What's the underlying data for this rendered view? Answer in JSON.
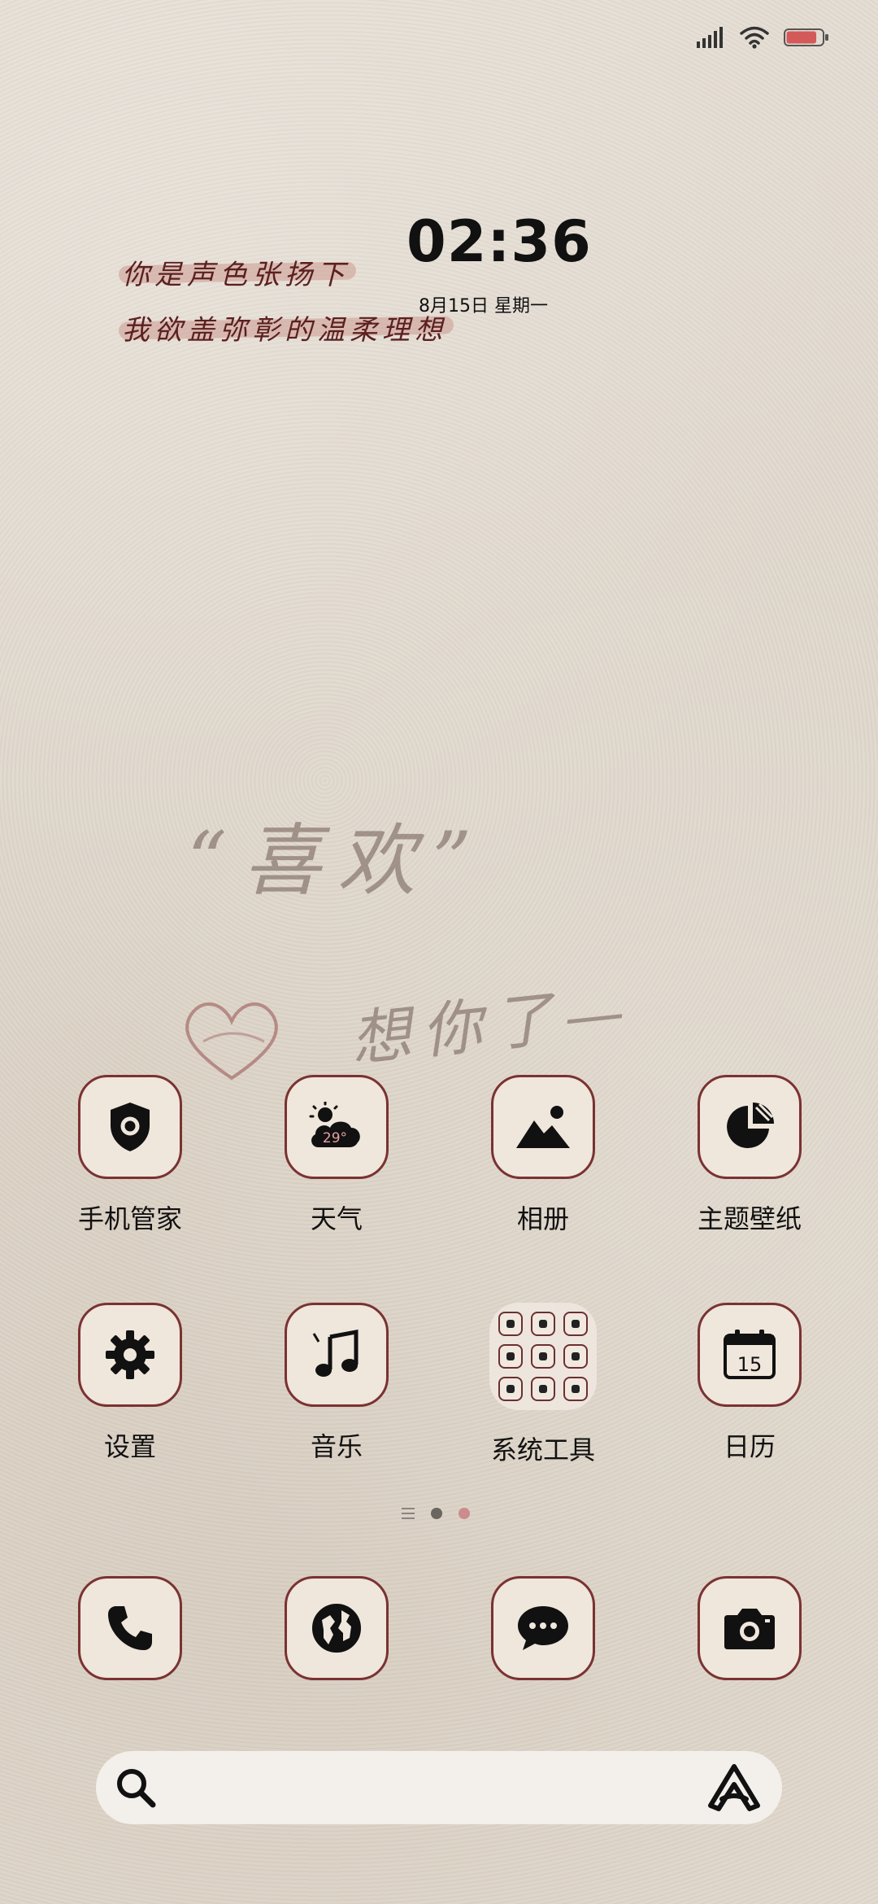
{
  "status_bar": {
    "signal_icon": "signal-bars-icon",
    "wifi_icon": "wifi-icon",
    "battery_icon": "battery-icon",
    "battery_level": 0.85,
    "battery_color": "#d45a5a"
  },
  "clock": {
    "time": "02:36",
    "date": "8月15日  星期一"
  },
  "wallpaper": {
    "line1": "你是声色张扬下",
    "line2": "我欲盖弥彰的温柔理想",
    "big1": "“喜欢”",
    "big2": "想你了—"
  },
  "apps": [
    {
      "label": "手机管家",
      "icon": "shield-icon"
    },
    {
      "label": "天气",
      "icon": "weather-icon",
      "temp": "29°"
    },
    {
      "label": "相册",
      "icon": "gallery-icon"
    },
    {
      "label": "主题壁纸",
      "icon": "theme-icon"
    },
    {
      "label": "设置",
      "icon": "gear-icon"
    },
    {
      "label": "音乐",
      "icon": "music-icon"
    },
    {
      "label": "系统工具",
      "icon": "folder-icon"
    },
    {
      "label": "日历",
      "icon": "calendar-icon",
      "day": "15"
    }
  ],
  "page_indicator": {
    "pages": 3,
    "current": 2,
    "active_color": "#cc8c8c",
    "dot_color": "#6a655f"
  },
  "dock": [
    {
      "icon": "phone-icon"
    },
    {
      "icon": "browser-icon"
    },
    {
      "icon": "messages-icon"
    },
    {
      "icon": "camera-icon"
    }
  ],
  "search": {
    "placeholder": "",
    "search_icon": "search-icon",
    "assistant_icon": "assistant-icon"
  },
  "colors": {
    "tile_border": "#7a3232",
    "tile_bg": "#efe6dc",
    "icon": "#111111"
  }
}
